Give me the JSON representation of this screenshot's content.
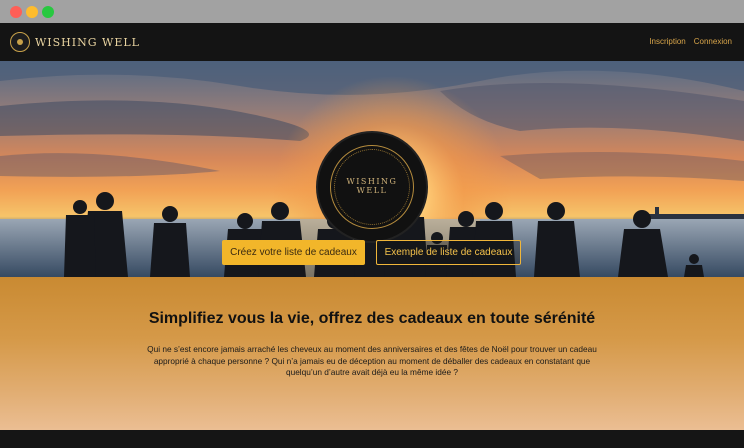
{
  "window": {
    "traffic_lights": [
      "close",
      "minimize",
      "zoom"
    ]
  },
  "nav": {
    "brand_name": "WISHING WELL",
    "links": [
      {
        "label": "Inscription"
      },
      {
        "label": "Connexion"
      }
    ]
  },
  "hero": {
    "seal_title_line1": "WISHING",
    "seal_title_line2": "WELL",
    "primary_button": "Créez votre liste de cadeaux",
    "secondary_button": "Exemple de liste de cadeaux"
  },
  "intro": {
    "heading": "Simplifiez vous la vie, offrez des cadeaux en toute sérénité",
    "body": "Qui ne s’est encore jamais arraché les cheveux au moment des anniversaires et des fêtes de Noël pour trouver un cadeau approprié à chaque personne ? Qui n’a jamais eu de déception au moment de déballer des cadeaux en constatant que quelqu’un d’autre avait déjà eu la même idée ?"
  },
  "colors": {
    "accent": "#f2b62a",
    "nav_bg": "#141414",
    "link": "#d8a54a",
    "intro_top": "#c98a32",
    "intro_bottom": "#ebbe93"
  }
}
